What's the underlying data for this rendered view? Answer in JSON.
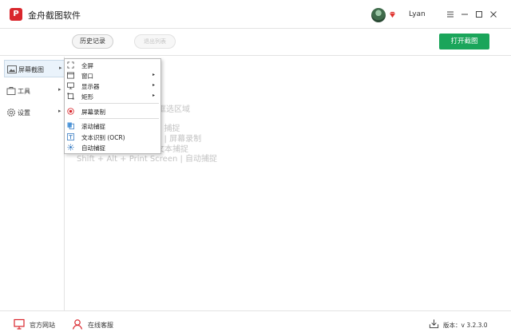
{
  "window": {
    "app_title": "金舟截图软件",
    "logo_glyph": "P",
    "username": "Lyan",
    "accent_color": "#1aa55a",
    "brand_color": "#d9262c"
  },
  "toolbar": {
    "history_label": "历史记录",
    "ghost_label": "退出列表",
    "open_capture_label": "打开截图"
  },
  "sidebar": {
    "items": [
      {
        "label": "屏幕截图",
        "icon": "screenshot-icon",
        "arrow": "▸"
      },
      {
        "label": "工具",
        "icon": "tools-icon",
        "arrow": "▸"
      },
      {
        "label": "设置",
        "icon": "gear-icon",
        "arrow": "▸"
      }
    ]
  },
  "hints": [
    "框选区域",
    "h 捕捉",
    "n | 屏幕录制",
    "文本捕捉",
    "Shift + Alt + Print Screen | 自动捕捉"
  ],
  "menu": {
    "items": [
      {
        "label": "全屏",
        "icon": "fullscreen-icon",
        "submenu": false
      },
      {
        "label": "窗口",
        "icon": "window-icon",
        "submenu": true
      },
      {
        "label": "显示器",
        "icon": "monitor-icon",
        "submenu": true
      },
      {
        "label": "矩形",
        "icon": "rectangle-icon",
        "submenu": true
      },
      {
        "label": "屏幕录制",
        "icon": "record-icon",
        "submenu": false
      },
      {
        "label": "滚动捕捉",
        "icon": "scroll-capture-icon",
        "submenu": false
      },
      {
        "label": "文本识别 (OCR)",
        "icon": "ocr-icon",
        "submenu": false
      },
      {
        "label": "自动捕捉",
        "icon": "auto-capture-icon",
        "submenu": false
      }
    ],
    "submenu_arrow": "▸"
  },
  "footer": {
    "website_label": "官方网站",
    "service_label": "在线客服",
    "version_label": "版本：v 3.2.3.0"
  }
}
